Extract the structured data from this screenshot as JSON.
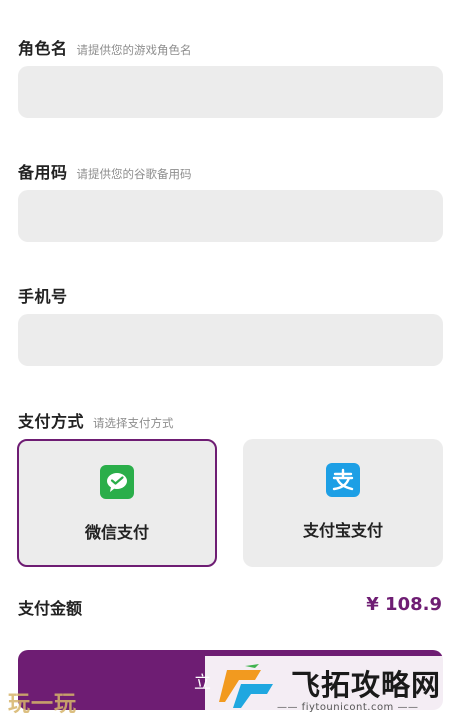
{
  "fields": [
    {
      "label": "角色名",
      "hint": "请提供您的游戏角色名",
      "value": ""
    },
    {
      "label": "备用码",
      "hint": "请提供您的谷歌备用码",
      "value": ""
    },
    {
      "label": "手机号",
      "hint": "",
      "value": ""
    }
  ],
  "payment": {
    "label": "支付方式",
    "hint": "请选择支付方式",
    "options": [
      {
        "name": "微信支付",
        "icon": "wechat-pay-icon",
        "selected": true,
        "color": "#2aae4a"
      },
      {
        "name": "支付宝支付",
        "icon": "alipay-icon",
        "selected": false,
        "color": "#1d9fe5"
      }
    ]
  },
  "amount": {
    "label": "支付金额",
    "value": "¥ 108.9"
  },
  "submit": {
    "label": "立"
  },
  "watermarks": {
    "left": "玩一玩",
    "right_title": "飞拓攻略网",
    "right_url": "—— fiytounicont.com ——"
  },
  "colors": {
    "accent": "#6e1d73",
    "input_bg": "#ececec"
  }
}
